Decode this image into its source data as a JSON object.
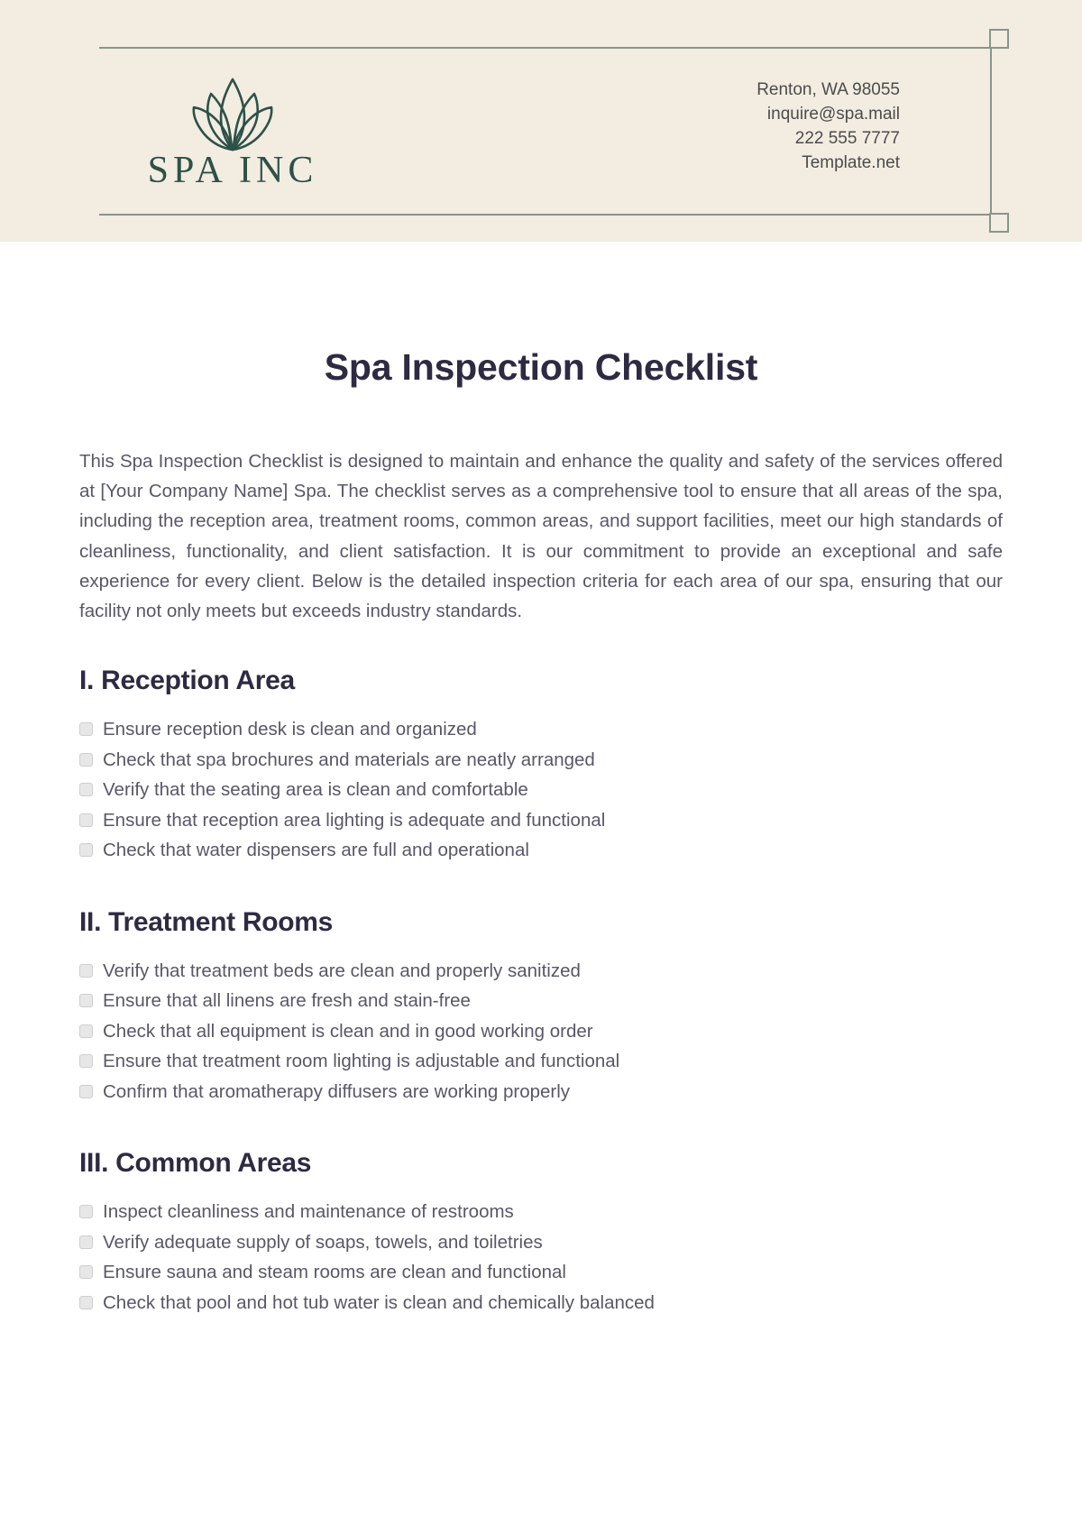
{
  "header": {
    "logo": {
      "mark": "lotus-flower-icon",
      "wordmark": "SPA INC"
    },
    "contact": [
      "Renton, WA 98055",
      "inquire@spa.mail",
      "222 555 7777",
      "Template.net"
    ],
    "colors": {
      "band_background": "#f2ece1",
      "rule": "#879688",
      "logo_green": "#2d5148"
    }
  },
  "document": {
    "title": "Spa Inspection Checklist",
    "intro": "This Spa Inspection Checklist is designed to maintain and enhance the quality and safety of the services offered at [Your Company Name] Spa. The checklist serves as a comprehensive tool to ensure that all areas of the spa, including the reception area, treatment rooms, common areas, and support facilities, meet our high standards of cleanliness, functionality, and client satisfaction. It is our commitment to provide an exceptional and safe experience for every client. Below is the detailed inspection criteria for each area of our spa, ensuring that our facility not only meets but exceeds industry standards.",
    "sections": [
      {
        "heading": "I. Reception Area",
        "items": [
          "Ensure reception desk is clean and organized",
          "Check that spa brochures and materials are neatly arranged",
          "Verify that the seating area is clean and comfortable",
          "Ensure that reception area lighting is adequate and functional",
          "Check that water dispensers are full and operational"
        ]
      },
      {
        "heading": "II. Treatment Rooms",
        "items": [
          "Verify that treatment beds are clean and properly sanitized",
          "Ensure that all linens are fresh and stain-free",
          "Check that all equipment is clean and in good working order",
          "Ensure that treatment room lighting is adjustable and functional",
          "Confirm that aromatherapy diffusers are working properly"
        ]
      },
      {
        "heading": "III. Common Areas",
        "items": [
          "Inspect cleanliness and maintenance of restrooms",
          "Verify adequate supply of soaps, towels, and toiletries",
          "Ensure sauna and steam rooms are clean and functional",
          "Check that pool and hot tub water is clean and chemically balanced"
        ]
      }
    ],
    "colors": {
      "title": "#2e2a42",
      "body_text": "#5a5668",
      "checkbox_fill": "#e7e7e7",
      "checkbox_border": "#cfcfcf"
    }
  }
}
